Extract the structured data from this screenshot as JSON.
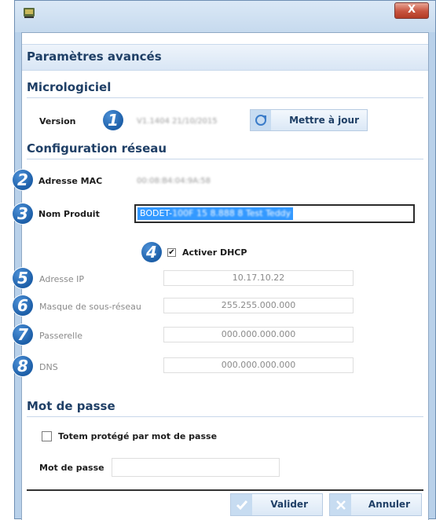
{
  "window": {
    "close_label": "X"
  },
  "header": {
    "title": "Paramètres avancés"
  },
  "firmware": {
    "section_title": "Micrologiciel",
    "version_label": "Version",
    "version_value": "V1.1404 21/10/2015",
    "update_button": "Mettre à jour",
    "badge": "1"
  },
  "network": {
    "section_title": "Configuration réseau",
    "mac": {
      "badge": "2",
      "label": "Adresse MAC",
      "value": "00:08:B4:04:9A:58"
    },
    "product": {
      "badge": "3",
      "label": "Nom Produit",
      "value_prefix": "BODET-",
      "value_blurred": "100F 15 8.888 8 Test Teddy"
    },
    "dhcp": {
      "badge": "4",
      "label": "Activer DHCP",
      "checked": true
    },
    "ip": {
      "badge": "5",
      "label": "Adresse IP",
      "value": "10.17.10.22"
    },
    "mask": {
      "badge": "6",
      "label": "Masque de sous-réseau",
      "value": "255.255.000.000"
    },
    "gateway": {
      "badge": "7",
      "label": "Passerelle",
      "value": "000.000.000.000"
    },
    "dns": {
      "badge": "8",
      "label": "DNS",
      "value": "000.000.000.000"
    }
  },
  "password": {
    "section_title": "Mot de passe",
    "protect_label": "Totem protégé par mot de passe",
    "protect_checked": false,
    "password_label": "Mot de passe",
    "password_value": ""
  },
  "footer": {
    "validate_button": "Valider",
    "cancel_button": "Annuler"
  },
  "colors": {
    "accent": "#1d5fa8",
    "title_text": "#1f3f66"
  }
}
